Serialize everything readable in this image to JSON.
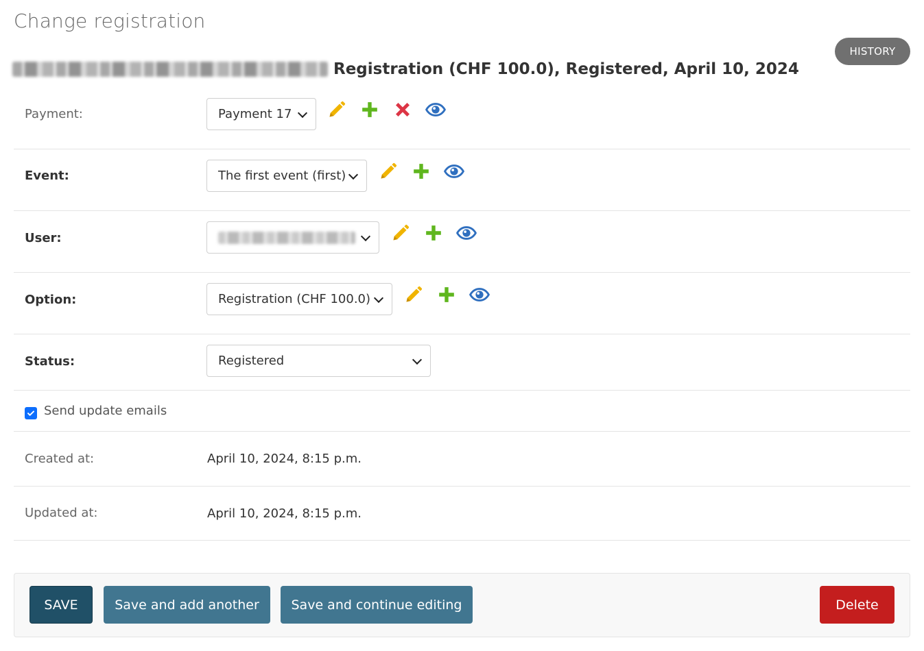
{
  "page": {
    "title": "Change registration"
  },
  "toolbar": {
    "history_label": "HISTORY"
  },
  "object": {
    "heading": "Registration (CHF 100.0), Registered, April 10, 2024"
  },
  "fields": {
    "payment": {
      "label": "Payment:",
      "value": "Payment 17"
    },
    "event": {
      "label": "Event:",
      "value": "The first event (first)"
    },
    "user": {
      "label": "User:",
      "value": ""
    },
    "option": {
      "label": "Option:",
      "value": "Registration (CHF 100.0)"
    },
    "status": {
      "label": "Status:",
      "value": "Registered"
    },
    "send_update_emails": {
      "label": "Send update emails",
      "checked": true
    },
    "created_at": {
      "label": "Created at:",
      "value": "April 10, 2024, 8:15 p.m."
    },
    "updated_at": {
      "label": "Updated at:",
      "value": "April 10, 2024, 8:15 p.m."
    }
  },
  "icons": {
    "change": "pencil-icon",
    "add": "plus-icon",
    "delete": "x-icon",
    "view": "eye-icon"
  },
  "colors": {
    "pencil": "#f0b400",
    "plus": "#5fb61e",
    "delete_x": "#dc3545",
    "eye": "#2f6fbf",
    "save_button": "#205067",
    "secondary_button": "#417690",
    "delete_button": "#c41e1e",
    "history_button": "#707070"
  },
  "actions": {
    "save": "SAVE",
    "save_add_another": "Save and add another",
    "save_continue": "Save and continue editing",
    "delete": "Delete"
  }
}
